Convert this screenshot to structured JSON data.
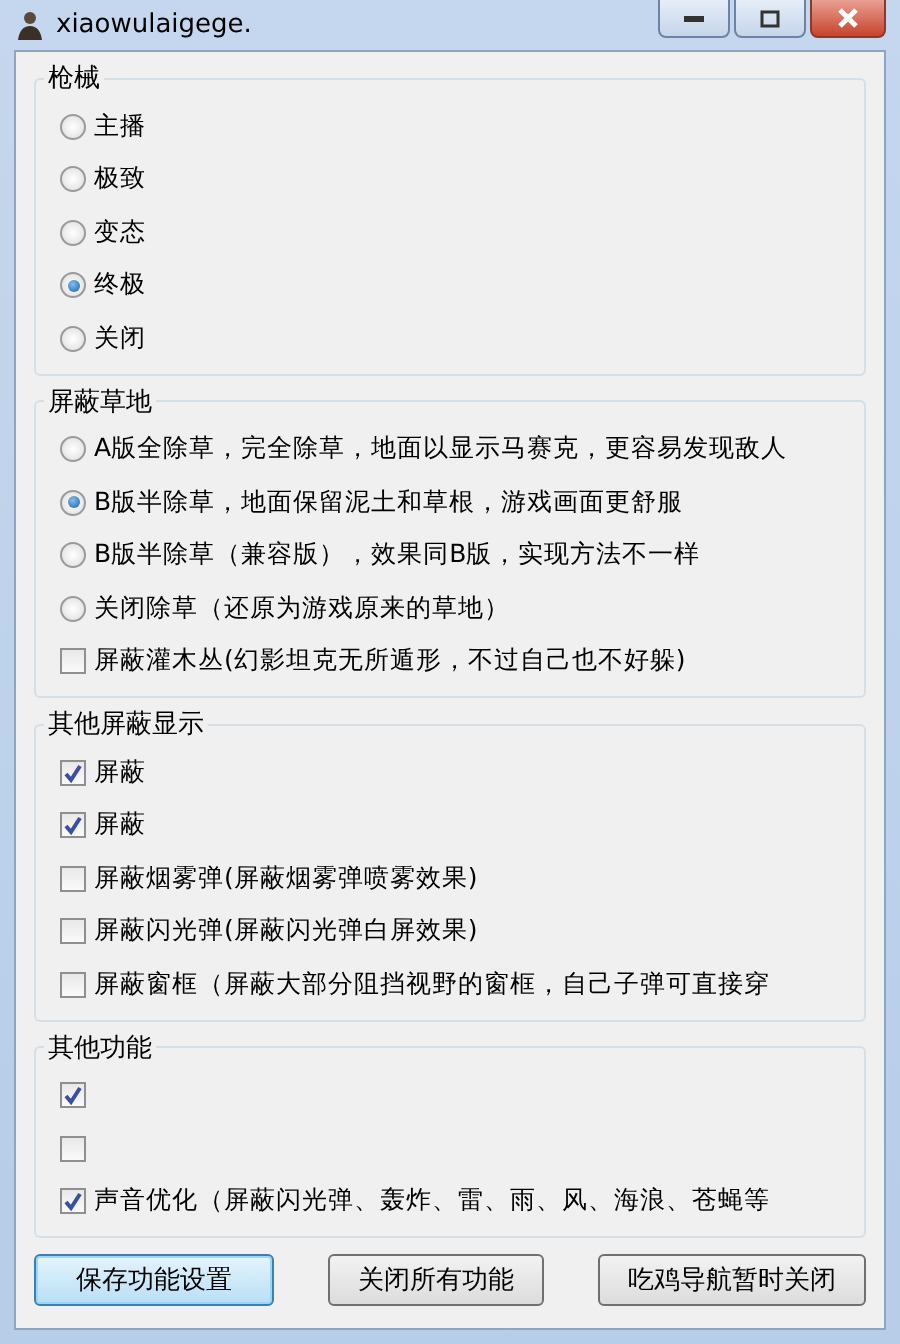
{
  "window": {
    "title": "xiaowulaigege."
  },
  "groups": [
    {
      "title": "枪械",
      "items": [
        {
          "kind": "radio",
          "label": "主播",
          "selected": false
        },
        {
          "kind": "radio",
          "label": "极致",
          "selected": false
        },
        {
          "kind": "radio",
          "label": "变态",
          "selected": false
        },
        {
          "kind": "radio",
          "label": "终极",
          "selected": true
        },
        {
          "kind": "radio",
          "label": "关闭",
          "selected": false
        }
      ]
    },
    {
      "title": "屏蔽草地",
      "items": [
        {
          "kind": "radio",
          "label": "A版全除草，完全除草，地面以显示马赛克，更容易发现敌人",
          "selected": false
        },
        {
          "kind": "radio",
          "label": "B版半除草，地面保留泥土和草根，游戏画面更舒服",
          "selected": true
        },
        {
          "kind": "radio",
          "label": "B版半除草（兼容版），效果同B版，实现方法不一样",
          "selected": false
        },
        {
          "kind": "radio",
          "label": "关闭除草（还原为游戏原来的草地）",
          "selected": false
        },
        {
          "kind": "checkbox",
          "label": "屏蔽灌木丛(幻影坦克无所遁形，不过自己也不好躲)",
          "checked": false
        }
      ]
    },
    {
      "title": "其他屏蔽显示",
      "items": [
        {
          "kind": "checkbox",
          "label": "屏蔽",
          "checked": true
        },
        {
          "kind": "checkbox",
          "label": "屏蔽",
          "checked": true
        },
        {
          "kind": "checkbox",
          "label": "屏蔽烟雾弹(屏蔽烟雾弹喷雾效果)",
          "checked": false
        },
        {
          "kind": "checkbox",
          "label": "屏蔽闪光弹(屏蔽闪光弹白屏效果)",
          "checked": false
        },
        {
          "kind": "checkbox",
          "label": "屏蔽窗框（屏蔽大部分阻挡视野的窗框，自己子弹可直接穿",
          "checked": false
        }
      ]
    },
    {
      "title": "其他功能",
      "items": [
        {
          "kind": "checkbox",
          "checked": true
        },
        {
          "kind": "checkbox",
          "checked": false
        },
        {
          "kind": "checkbox",
          "label": "声音优化（屏蔽闪光弹、轰炸、雷、雨、风、海浪、苍蝇等",
          "checked": true
        }
      ]
    }
  ],
  "buttons": [
    {
      "label": "保存功能设置",
      "selected": true
    },
    {
      "label": "关闭所有功能",
      "selected": false
    },
    {
      "label": "吃鸡导航暂时关闭",
      "selected": false
    }
  ]
}
